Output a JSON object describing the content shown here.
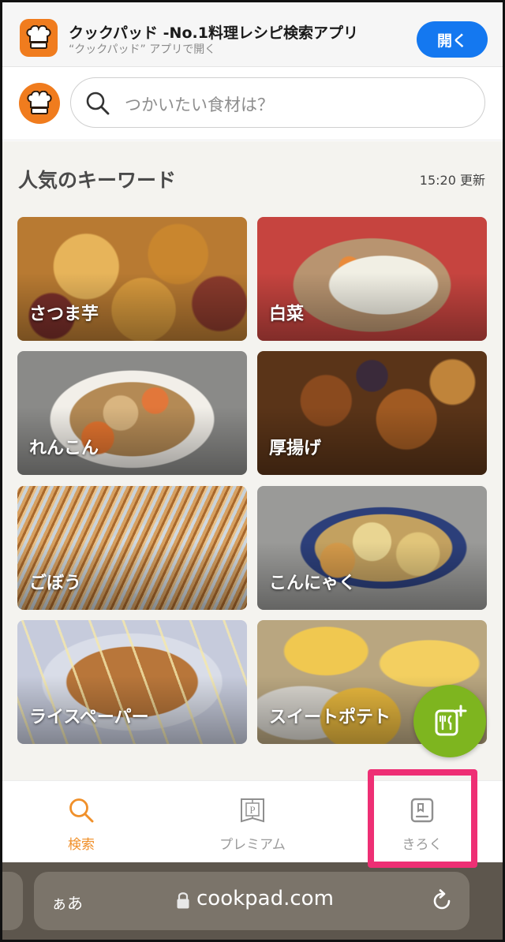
{
  "app_banner": {
    "title": "クックパッド -No.1料理レシピ検索アプリ",
    "subtitle": "“クックパッド” アプリで開く",
    "open_label": "開く"
  },
  "search": {
    "placeholder": "つかいたい食材は？"
  },
  "keywords": {
    "title": "人気のキーワード",
    "updated": "15:20 更新",
    "items": [
      {
        "label": "さつま芋"
      },
      {
        "label": "白菜"
      },
      {
        "label": "れんこん"
      },
      {
        "label": "厚揚げ"
      },
      {
        "label": "ごぼう"
      },
      {
        "label": "こんにゃく"
      },
      {
        "label": "ライスペーパー"
      },
      {
        "label": "スイートポテト"
      }
    ]
  },
  "tabs": [
    {
      "label": "検索",
      "icon": "search-icon",
      "active": true
    },
    {
      "label": "プレミアム",
      "icon": "premium-icon",
      "active": false
    },
    {
      "label": "きろく",
      "icon": "record-icon",
      "active": false
    }
  ],
  "browser": {
    "text_size": "ぁあ",
    "url": "cookpad.com"
  },
  "colors": {
    "brand": "#f07c1e",
    "open_button": "#1478f0",
    "fab": "#7eb51f",
    "highlight": "#ee2f74",
    "tab_active": "#f0902a",
    "tab_inactive": "#9a9a9a"
  }
}
